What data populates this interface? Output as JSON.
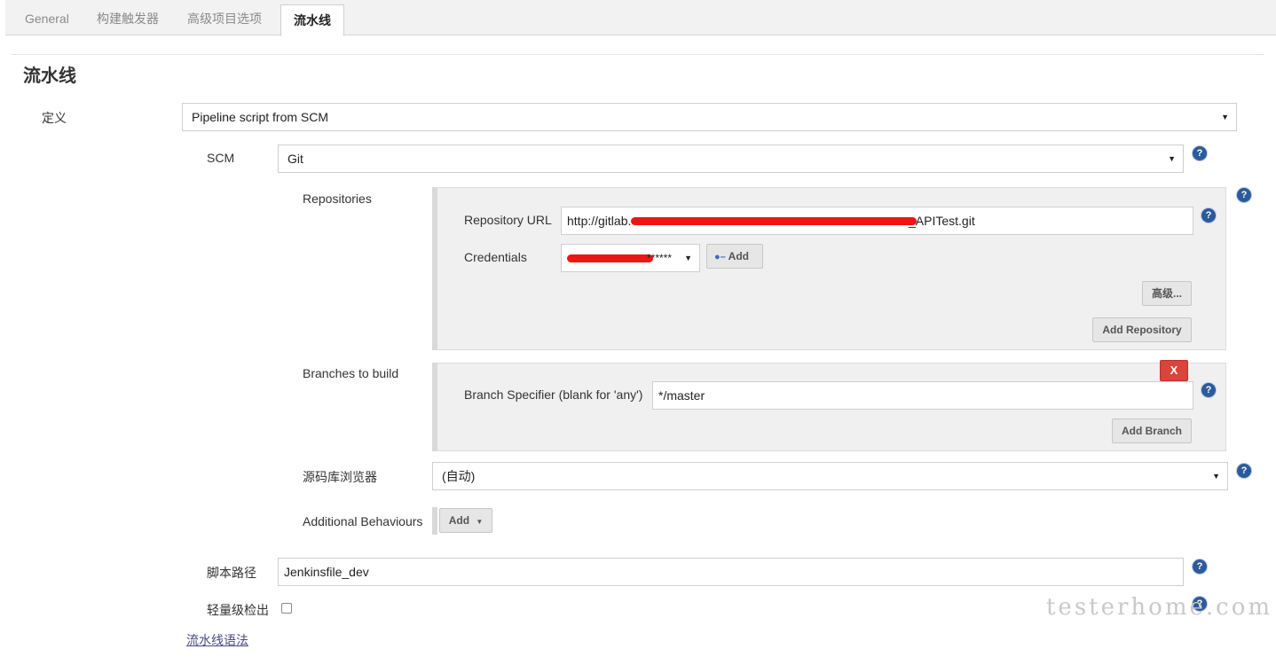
{
  "tabs": [
    {
      "label": "General",
      "active": false
    },
    {
      "label": "构建触发器",
      "active": false
    },
    {
      "label": "高级项目选项",
      "active": false
    },
    {
      "label": "流水线",
      "active": true
    }
  ],
  "section": {
    "title": "流水线"
  },
  "definition": {
    "label": "定义",
    "value": "Pipeline script from SCM"
  },
  "scm": {
    "label": "SCM",
    "value": "Git"
  },
  "repositories": {
    "label": "Repositories",
    "url_label": "Repository URL",
    "url_start": "http://gitlab.",
    "url_end": "_APITest.git",
    "credentials_label": "Credentials",
    "credentials_value": "******",
    "add_label": "Add",
    "advanced_label": "高级...",
    "add_repository_label": "Add Repository"
  },
  "branches": {
    "label": "Branches to build",
    "remove_label": "X",
    "specifier_label": "Branch Specifier (blank for 'any')",
    "specifier_value": "*/master",
    "add_branch_label": "Add Branch"
  },
  "browser": {
    "label": "源码库浏览器",
    "value": "(自动)"
  },
  "behaviours": {
    "label": "Additional Behaviours",
    "add_label": "Add"
  },
  "script_path": {
    "label": "脚本路径",
    "value": "Jenkinsfile_dev"
  },
  "lightweight": {
    "label": "轻量级检出",
    "checked": false
  },
  "syntax_link": {
    "label": "流水线语法"
  },
  "help_glyph": "?",
  "watermark": "testerhome.com",
  "colors": {
    "help": "#2c5a9c",
    "danger": "#d9443c",
    "redaction": "#ee1515"
  }
}
